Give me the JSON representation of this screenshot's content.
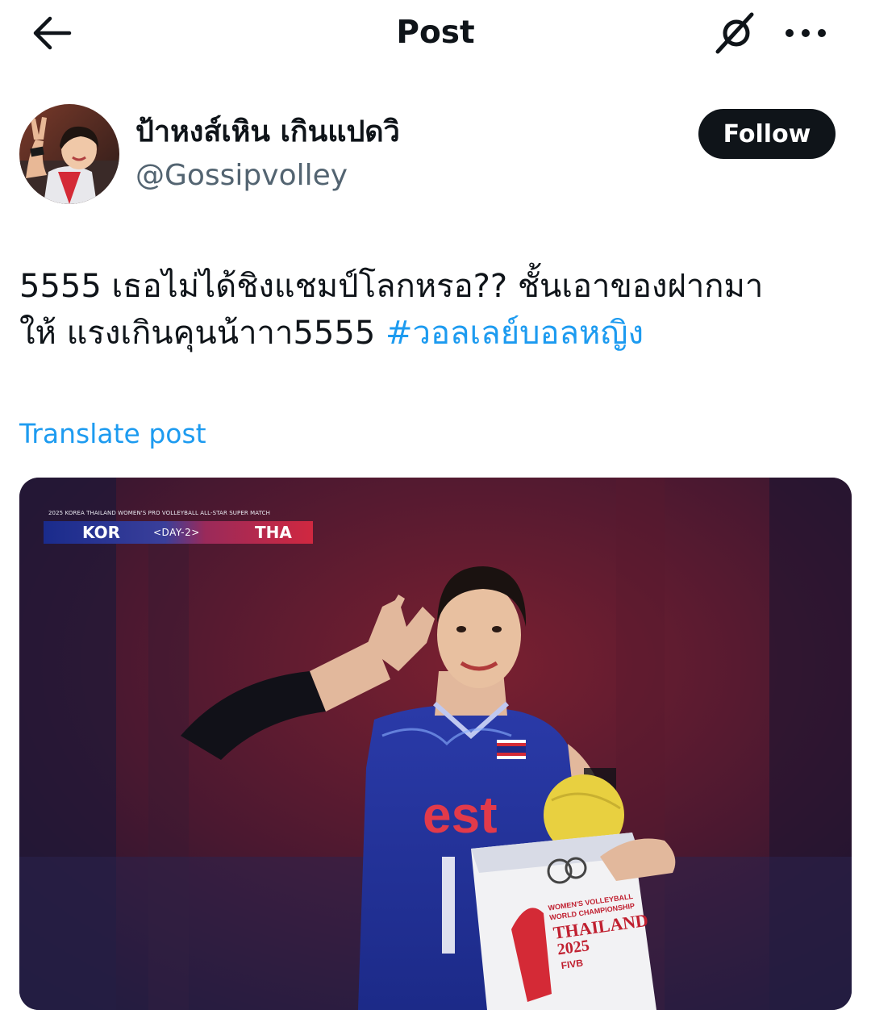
{
  "header": {
    "title": "Post",
    "back_icon": "arrow-left-icon",
    "grok_icon": "grok-icon",
    "more_icon": "more-horizontal-icon"
  },
  "author": {
    "display_name": "ป้าหงส์เหิน เกินแปดวิ",
    "handle": "@Gossipvolley",
    "follow_label": "Follow"
  },
  "post": {
    "text_line1": "5555 เธอไม่ได้ชิงแชมป์โลกหรอ?? ชั้นเอาของฝากมา",
    "text_line2": "ให้ แรงเกินคุนน้าาา5555",
    "hashtag": "#วอลเลย์บอลหญิง",
    "translate_label": "Translate post"
  },
  "media": {
    "scoreboard_title": "2025 KOREA THAILAND WOMEN'S PRO VOLLEYBALL ALL-STAR SUPER MATCH",
    "team_left": "KOR",
    "day_label": "<DAY-2>",
    "team_right": "THA",
    "jersey_sponsor": "est",
    "bag_text_line1": "WOMEN'S VOLLEYBALL",
    "bag_text_line2": "WORLD CHAMPIONSHIP",
    "bag_text_line3": "THAILAND",
    "bag_text_line4": "2025",
    "bag_text_line5": "FIVB"
  },
  "colors": {
    "accent": "#1d9bf0",
    "text_primary": "#0f1419",
    "text_secondary": "#536471",
    "follow_bg": "#0f1419"
  }
}
